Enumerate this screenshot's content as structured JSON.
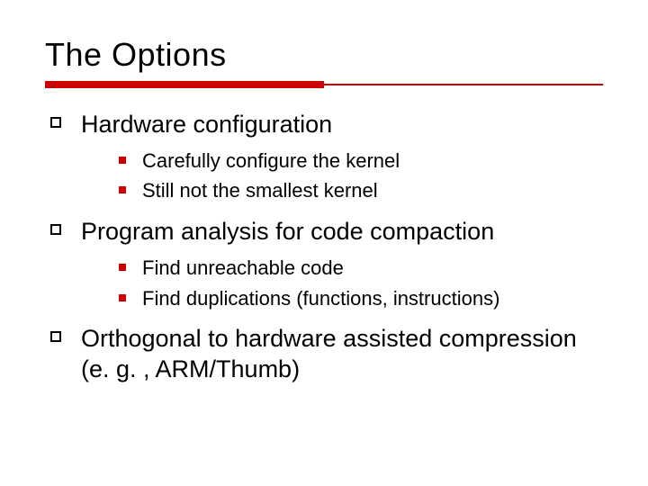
{
  "title": "The Options",
  "bullets": {
    "b1": {
      "text": "Hardware configuration",
      "sub": {
        "s1": "Carefully configure the kernel",
        "s2": "Still not the smallest kernel"
      }
    },
    "b2": {
      "text": "Program analysis for code compaction",
      "sub": {
        "s1": "Find unreachable code",
        "s2": "Find duplications (functions, instructions)"
      }
    },
    "b3": {
      "text": "Orthogonal to hardware assisted compression (e. g. , ARM/Thumb)"
    }
  }
}
